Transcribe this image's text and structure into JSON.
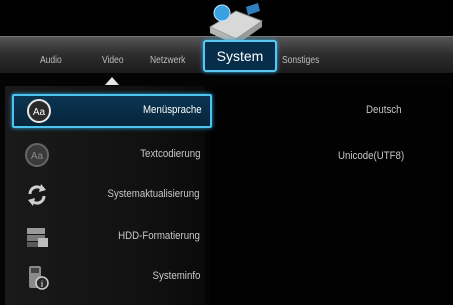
{
  "tabs": [
    {
      "label": "Audio"
    },
    {
      "label": "Video"
    },
    {
      "label": "Netzwerk"
    },
    {
      "label": "System"
    },
    {
      "label": "Sonstiges"
    }
  ],
  "active_tab": "System",
  "menu": {
    "items": [
      {
        "label": "Menüsprache",
        "icon": "language-icon",
        "value": "Deutsch",
        "selected": true
      },
      {
        "label": "Textcodierung",
        "icon": "text-encoding-icon",
        "value": "Unicode(UTF8)",
        "selected": false
      },
      {
        "label": "Systemaktualisierung",
        "icon": "refresh-icon",
        "value": "",
        "selected": false
      },
      {
        "label": "HDD-Formatierung",
        "icon": "hdd-icon",
        "value": "",
        "selected": false
      },
      {
        "label": "Systeminfo",
        "icon": "info-icon",
        "value": "",
        "selected": false
      }
    ]
  },
  "colors": {
    "accent": "#4fc3f0",
    "selected_bg": "#0b3552",
    "background": "#040404"
  }
}
